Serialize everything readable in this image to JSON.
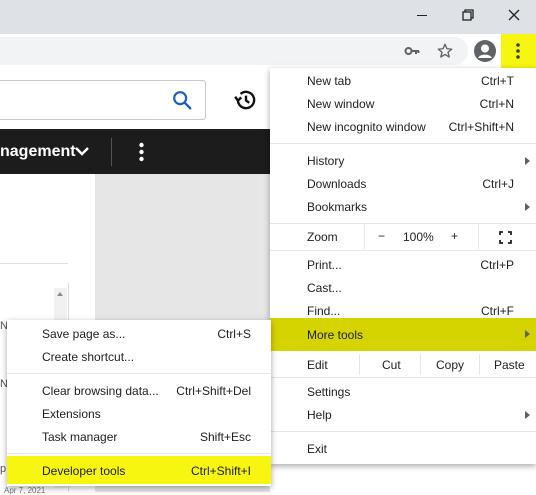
{
  "colors": {
    "highlight": "#f6f611",
    "highlight_strong": "#d5d400",
    "titlebar": "#dee1e6",
    "navbar": "#1c1c1c"
  },
  "window_controls": {
    "minimize_icon": "minimize-icon",
    "restore_icon": "restore-icon",
    "close_icon": "close-icon"
  },
  "toolbar": {
    "key_icon": "key-icon",
    "star_icon": "star-icon",
    "profile_icon": "profile-icon",
    "menu_icon": "vertical-dots-icon"
  },
  "page": {
    "nav_label": "nagement",
    "nav_chevron": "chevron-down-icon",
    "nav_menu_icon": "vertical-dots-icon",
    "search_icon": "search-icon",
    "history_icon": "history-icon",
    "fragment_left_1": "N",
    "fragment_left_2": "p",
    "fragment_date": "Apr 7, 2021"
  },
  "main_menu": {
    "new_tab": {
      "label": "New tab",
      "shortcut": "Ctrl+T"
    },
    "new_window": {
      "label": "New window",
      "shortcut": "Ctrl+N"
    },
    "new_incognito": {
      "label": "New incognito window",
      "shortcut": "Ctrl+Shift+N"
    },
    "history": {
      "label": "History"
    },
    "downloads": {
      "label": "Downloads",
      "shortcut": "Ctrl+J"
    },
    "bookmarks": {
      "label": "Bookmarks"
    },
    "zoom": {
      "label": "Zoom",
      "minus": "−",
      "value": "100%",
      "plus": "+",
      "fullscreen_icon": "fullscreen-icon"
    },
    "print": {
      "label": "Print...",
      "shortcut": "Ctrl+P"
    },
    "cast": {
      "label": "Cast..."
    },
    "find": {
      "label": "Find...",
      "shortcut": "Ctrl+F"
    },
    "more_tools": {
      "label": "More tools"
    },
    "edit": {
      "label": "Edit",
      "cut": "Cut",
      "copy": "Copy",
      "paste": "Paste"
    },
    "settings": {
      "label": "Settings"
    },
    "help": {
      "label": "Help"
    },
    "exit": {
      "label": "Exit"
    }
  },
  "sub_menu": {
    "save_page": {
      "label": "Save page as...",
      "shortcut": "Ctrl+S"
    },
    "create_shortcut": {
      "label": "Create shortcut..."
    },
    "clear_browsing": {
      "label": "Clear browsing data...",
      "shortcut": "Ctrl+Shift+Del"
    },
    "extensions": {
      "label": "Extensions"
    },
    "task_manager": {
      "label": "Task manager",
      "shortcut": "Shift+Esc"
    },
    "developer_tools": {
      "label": "Developer tools",
      "shortcut": "Ctrl+Shift+I"
    }
  }
}
